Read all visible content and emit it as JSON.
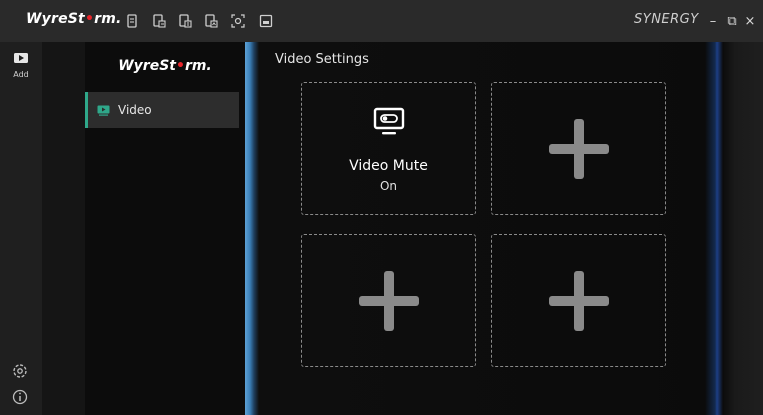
{
  "titlebar": {
    "brand_prefix": "WyreSt",
    "brand_dot": "•",
    "brand_suffix": "rm.",
    "product": "SYNERGY",
    "minimize": "–",
    "restore": "⧉",
    "close": "×"
  },
  "rail": {
    "add_label": "Add"
  },
  "panel": {
    "logo_prefix": "WyreSt",
    "logo_dot": "•",
    "logo_suffix": "rm.",
    "nav": [
      {
        "label": "Video",
        "active": true
      }
    ]
  },
  "main": {
    "title": "Video Settings",
    "tiles": [
      {
        "name": "Video Mute",
        "state": "On"
      }
    ]
  },
  "colors": {
    "accent": "#2fa88a",
    "brand_red": "#e8242a",
    "tile_border": "#8a8a8a"
  },
  "icons": {
    "titlebar": [
      "document-icon",
      "export-icon",
      "import-icon",
      "upload-icon",
      "camera-capture-icon",
      "screen-icon"
    ],
    "rail_add": "add-device-icon",
    "rail_settings": "gear-icon",
    "rail_info": "info-icon",
    "nav_video": "video-icon",
    "tile_video_mute": "monitor-toggle-icon",
    "tile_empty": "plus-icon"
  }
}
